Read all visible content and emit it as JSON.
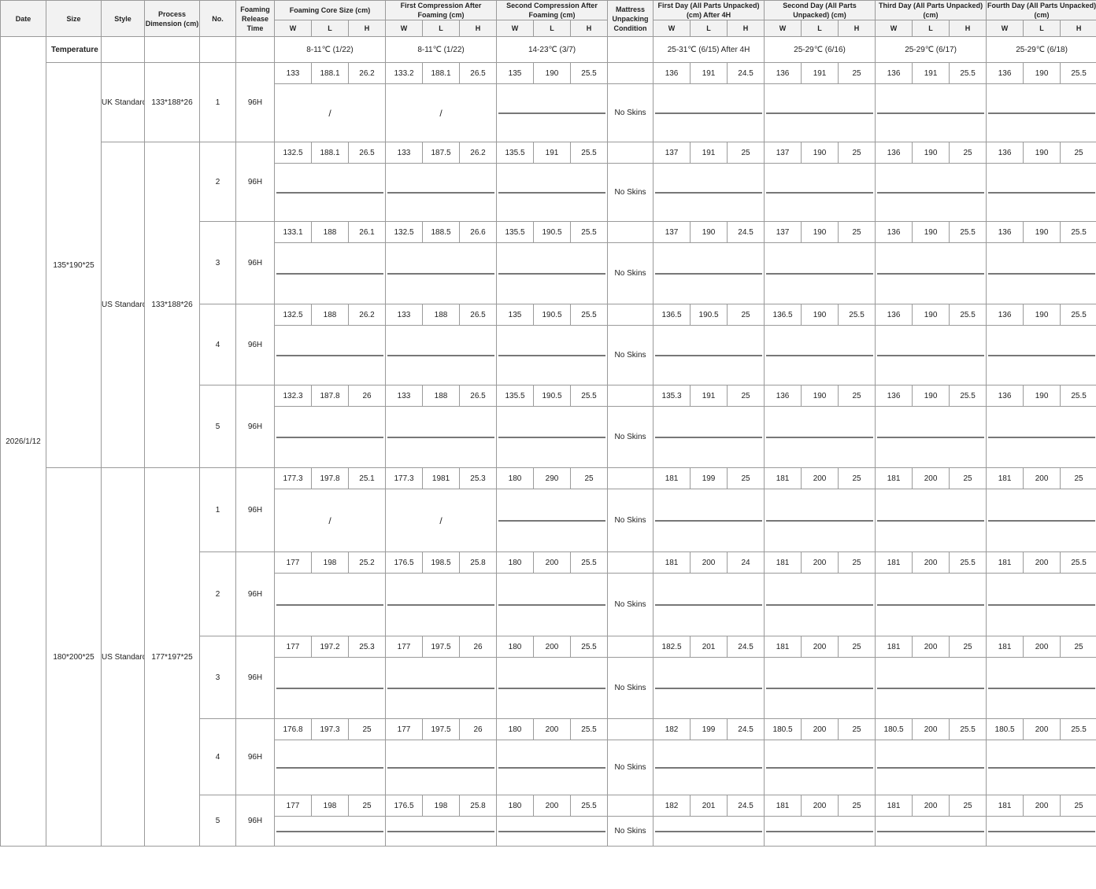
{
  "headers": {
    "date": "Date",
    "size": "Size",
    "style": "Style",
    "process_dimension": "Process Dimension (cm)",
    "no": "No.",
    "foaming_release_time": "Foaming Release Time",
    "foaming_core_size": "Foaming Core Size (cm)",
    "first_compression": "First Compression After Foaming (cm)",
    "second_compression": "Second Compression After Foaming (cm)",
    "unpacking_condition": "Mattress Unpacking Condition",
    "day1": "First Day (All Parts Unpacked) (cm) After 4H",
    "day2": "Second Day (All Parts Unpacked) (cm)",
    "day3": "Third Day (All Parts Unpacked) (cm)",
    "day4": "Fourth Day (All Parts Unpacked) (cm)",
    "w": "W",
    "l": "L",
    "h": "H"
  },
  "temperature_label": "Temperature",
  "temperatures": [
    "8-11℃ (1/22)",
    "8-11℃ (1/22)",
    "14-23℃ (3/7)",
    "25-31℃ (6/15) After 4H",
    "25-29℃ (6/16)",
    "25-29℃ (6/17)",
    "25-29℃ (6/18)"
  ],
  "date": "2026/1/12",
  "groups": [
    {
      "size": "135*190*25",
      "styles": [
        {
          "style": "UK Standard",
          "dim": "133*188*26",
          "span": 1
        },
        {
          "style": "US Standard",
          "dim": "133*188*26",
          "span": 4
        }
      ],
      "rows": [
        {
          "no": "1",
          "time": "96H",
          "cond": "No Skins",
          "m": [
            "133",
            "188.1",
            "26.2",
            "133.2",
            "188.1",
            "26.5",
            "135",
            "190",
            "25.5",
            "136",
            "191",
            "24.5",
            "136",
            "191",
            "25",
            "136",
            "191",
            "25.5",
            "136",
            "190",
            "25.5"
          ],
          "photos": [
            "slash",
            "slash",
            "wrap",
            "stack",
            "stack",
            "stack",
            "stack"
          ]
        },
        {
          "no": "2",
          "time": "96H",
          "cond": "No Skins",
          "m": [
            "132.5",
            "188.1",
            "26.5",
            "133",
            "187.5",
            "26.2",
            "135.5",
            "191",
            "25.5",
            "137",
            "191",
            "25",
            "137",
            "190",
            "25",
            "136",
            "190",
            "25",
            "136",
            "190",
            "25"
          ],
          "photos": [
            "foam",
            "mat",
            "wrap",
            "stack",
            "stack",
            "stack",
            "stack"
          ]
        },
        {
          "no": "3",
          "time": "96H",
          "cond": "No Skins",
          "m": [
            "133.1",
            "188",
            "26.1",
            "132.5",
            "188.5",
            "26.6",
            "135.5",
            "190.5",
            "25.5",
            "137",
            "190",
            "24.5",
            "137",
            "190",
            "25",
            "136",
            "190",
            "25.5",
            "136",
            "190",
            "25.5"
          ],
          "photos": [
            "foam",
            "mat",
            "wrap",
            "stack",
            "stack",
            "stack",
            "stack"
          ]
        },
        {
          "no": "4",
          "time": "96H",
          "cond": "No Skins",
          "m": [
            "132.5",
            "188",
            "26.2",
            "133",
            "188",
            "26.5",
            "135",
            "190.5",
            "25.5",
            "136.5",
            "190.5",
            "25",
            "136.5",
            "190",
            "25.5",
            "136",
            "190",
            "25.5",
            "136",
            "190",
            "25.5"
          ],
          "photos": [
            "foam",
            "mat",
            "wrap",
            "stack",
            "stack",
            "stack",
            "stack"
          ]
        },
        {
          "no": "5",
          "time": "96H",
          "cond": "No Skins",
          "m": [
            "132.3",
            "187.8",
            "26",
            "133",
            "188",
            "26.5",
            "135.5",
            "190.5",
            "25.5",
            "135.3",
            "191",
            "25",
            "136",
            "190",
            "25",
            "136",
            "190",
            "25.5",
            "136",
            "190",
            "25.5"
          ],
          "photos": [
            "foam",
            "mat",
            "wrap",
            "stack",
            "stack",
            "stack",
            "stack"
          ]
        }
      ]
    },
    {
      "size": "180*200*25",
      "styles": [
        {
          "style": "US Standard",
          "dim": "177*197*25",
          "span": 5
        }
      ],
      "rows": [
        {
          "no": "1",
          "time": "96H",
          "cond": "No Skins",
          "m": [
            "177.3",
            "197.8",
            "25.1",
            "177.3",
            "1981",
            "25.3",
            "180",
            "290",
            "25",
            "181",
            "199",
            "25",
            "181",
            "200",
            "25",
            "181",
            "200",
            "25",
            "181",
            "200",
            "25"
          ],
          "photos": [
            "slash",
            "slash",
            "wrap",
            "stackw",
            "stackw",
            "stackw",
            "stackw"
          ]
        },
        {
          "no": "2",
          "time": "96H",
          "cond": "No Skins",
          "m": [
            "177",
            "198",
            "25.2",
            "176.5",
            "198.5",
            "25.8",
            "180",
            "200",
            "25.5",
            "181",
            "200",
            "24",
            "181",
            "200",
            "25",
            "181",
            "200",
            "25.5",
            "181",
            "200",
            "25.5"
          ],
          "photos": [
            "foam",
            "mat",
            "wrap",
            "stackw",
            "stackw",
            "stackw",
            "stackw"
          ]
        },
        {
          "no": "3",
          "time": "96H",
          "cond": "No Skins",
          "m": [
            "177",
            "197.2",
            "25.3",
            "177",
            "197.5",
            "26",
            "180",
            "200",
            "25.5",
            "182.5",
            "201",
            "24.5",
            "181",
            "200",
            "25",
            "181",
            "200",
            "25",
            "181",
            "200",
            "25"
          ],
          "photos": [
            "foam",
            "mat",
            "wrap",
            "stackw",
            "stackw",
            "stackw",
            "stackw"
          ]
        },
        {
          "no": "4",
          "time": "96H",
          "cond": "No Skins",
          "m": [
            "176.8",
            "197.3",
            "25",
            "177",
            "197.5",
            "26",
            "180",
            "200",
            "25.5",
            "182",
            "199",
            "24.5",
            "180.5",
            "200",
            "25",
            "180.5",
            "200",
            "25.5",
            "180.5",
            "200",
            "25.5"
          ],
          "photos": [
            "foam",
            "mat",
            "wrap",
            "stackw",
            "stackw",
            "stackw",
            "stackw"
          ]
        },
        {
          "no": "5",
          "time": "96H",
          "cond": "No Skins",
          "m": [
            "177",
            "198",
            "25",
            "176.5",
            "198",
            "25.8",
            "180",
            "200",
            "25.5",
            "182",
            "201",
            "24.5",
            "181",
            "200",
            "25",
            "181",
            "200",
            "25",
            "181",
            "200",
            "25"
          ],
          "photos": [
            "foam",
            "mat",
            "wrap",
            "stackw",
            "stackw",
            "stackw",
            "stackw"
          ]
        }
      ]
    }
  ]
}
